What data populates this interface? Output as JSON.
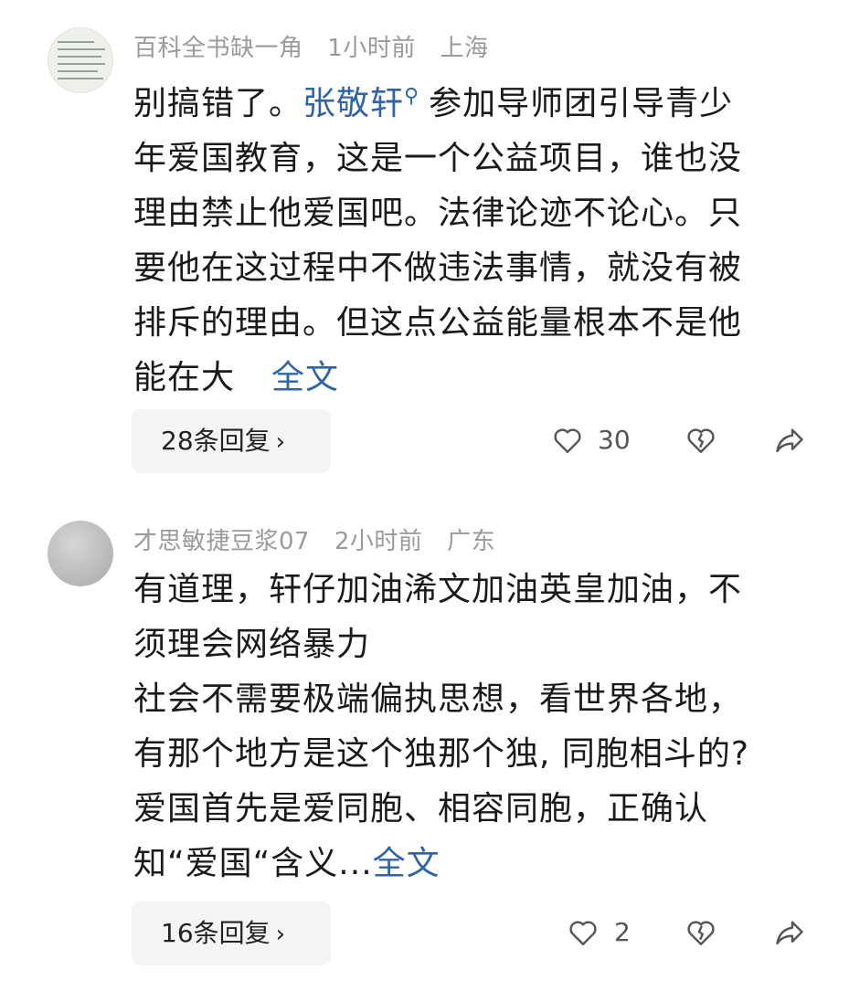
{
  "comments": [
    {
      "author": "百科全书缺一角",
      "time": "1小时前",
      "location": "上海",
      "avatar_icon": "document-thumbnail-avatar",
      "lines": {
        "l1_prefix": "别搞错了。",
        "l1_mention": "张敬轩",
        "l1_rest": "参加导师团引导青少",
        "l2": "年爱国教育，这是一个公益项目，谁也没",
        "l3": "理由禁止他爱国吧。法律论迹不论心。只",
        "l4": "要他在这过程中不做违法事情，就没有被",
        "l5": "排斥的理由。但这点公益能量根本不是他",
        "l6": "能在大"
      },
      "more_label": "全文",
      "reply_label": "28条回复",
      "like_count": "30"
    },
    {
      "author": "才思敏捷豆浆07",
      "time": "2小时前",
      "location": "广东",
      "avatar_icon": "gray-circle-avatar",
      "lines": {
        "l1": "有道理，轩仔加油浠文加油英皇加油，不",
        "l2": "须理会网络暴力",
        "l3": "社会不需要极端偏执思想，看世界各地，",
        "l4": "有那个地方是这个独那个独, 同胞相斗的?",
        "l5": "爱国首先是爱同胞、相容同胞，正确认",
        "l6": "知“爱国“含义..."
      },
      "more_label": "全文",
      "reply_label": "16条回复",
      "like_count": "2"
    }
  ],
  "icons": {
    "like": "heart-outline-icon",
    "dislike": "broken-heart-icon",
    "share": "share-arrow-icon",
    "chevron": "chevron-right-icon",
    "search": "search-icon"
  },
  "colors": {
    "link": "#2f64a8",
    "meta": "#9a9a9a",
    "text": "#1a1a1a",
    "reply_bg": "#f4f4f4",
    "icon": "#555555"
  }
}
